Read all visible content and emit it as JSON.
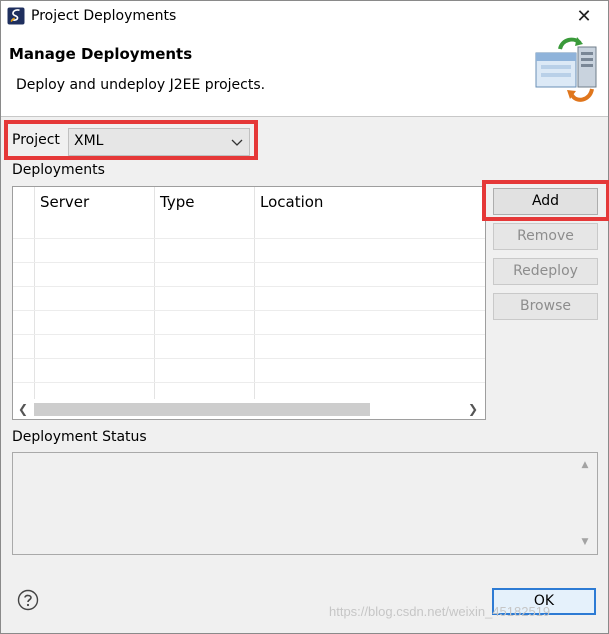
{
  "window": {
    "title": "Project Deployments",
    "close_glyph": "✕"
  },
  "banner": {
    "title": "Manage Deployments",
    "description": "Deploy and undeploy J2EE projects.",
    "icon": "deploy-server-icon"
  },
  "project": {
    "label": "Project",
    "selected": "XML"
  },
  "deployments": {
    "label": "Deployments",
    "columns": [
      "Server",
      "Type",
      "Location"
    ],
    "rows": []
  },
  "buttons": {
    "add": "Add",
    "remove": "Remove",
    "redeploy": "Redeploy",
    "browse": "Browse"
  },
  "status": {
    "label": "Deployment Status",
    "text": ""
  },
  "footer": {
    "ok": "OK",
    "help_icon": "help-icon"
  },
  "watermark": "https://blog.csdn.net/weixin_45182519",
  "colors": {
    "highlight": "#e53838",
    "default_button_border": "#2d7bd4"
  }
}
